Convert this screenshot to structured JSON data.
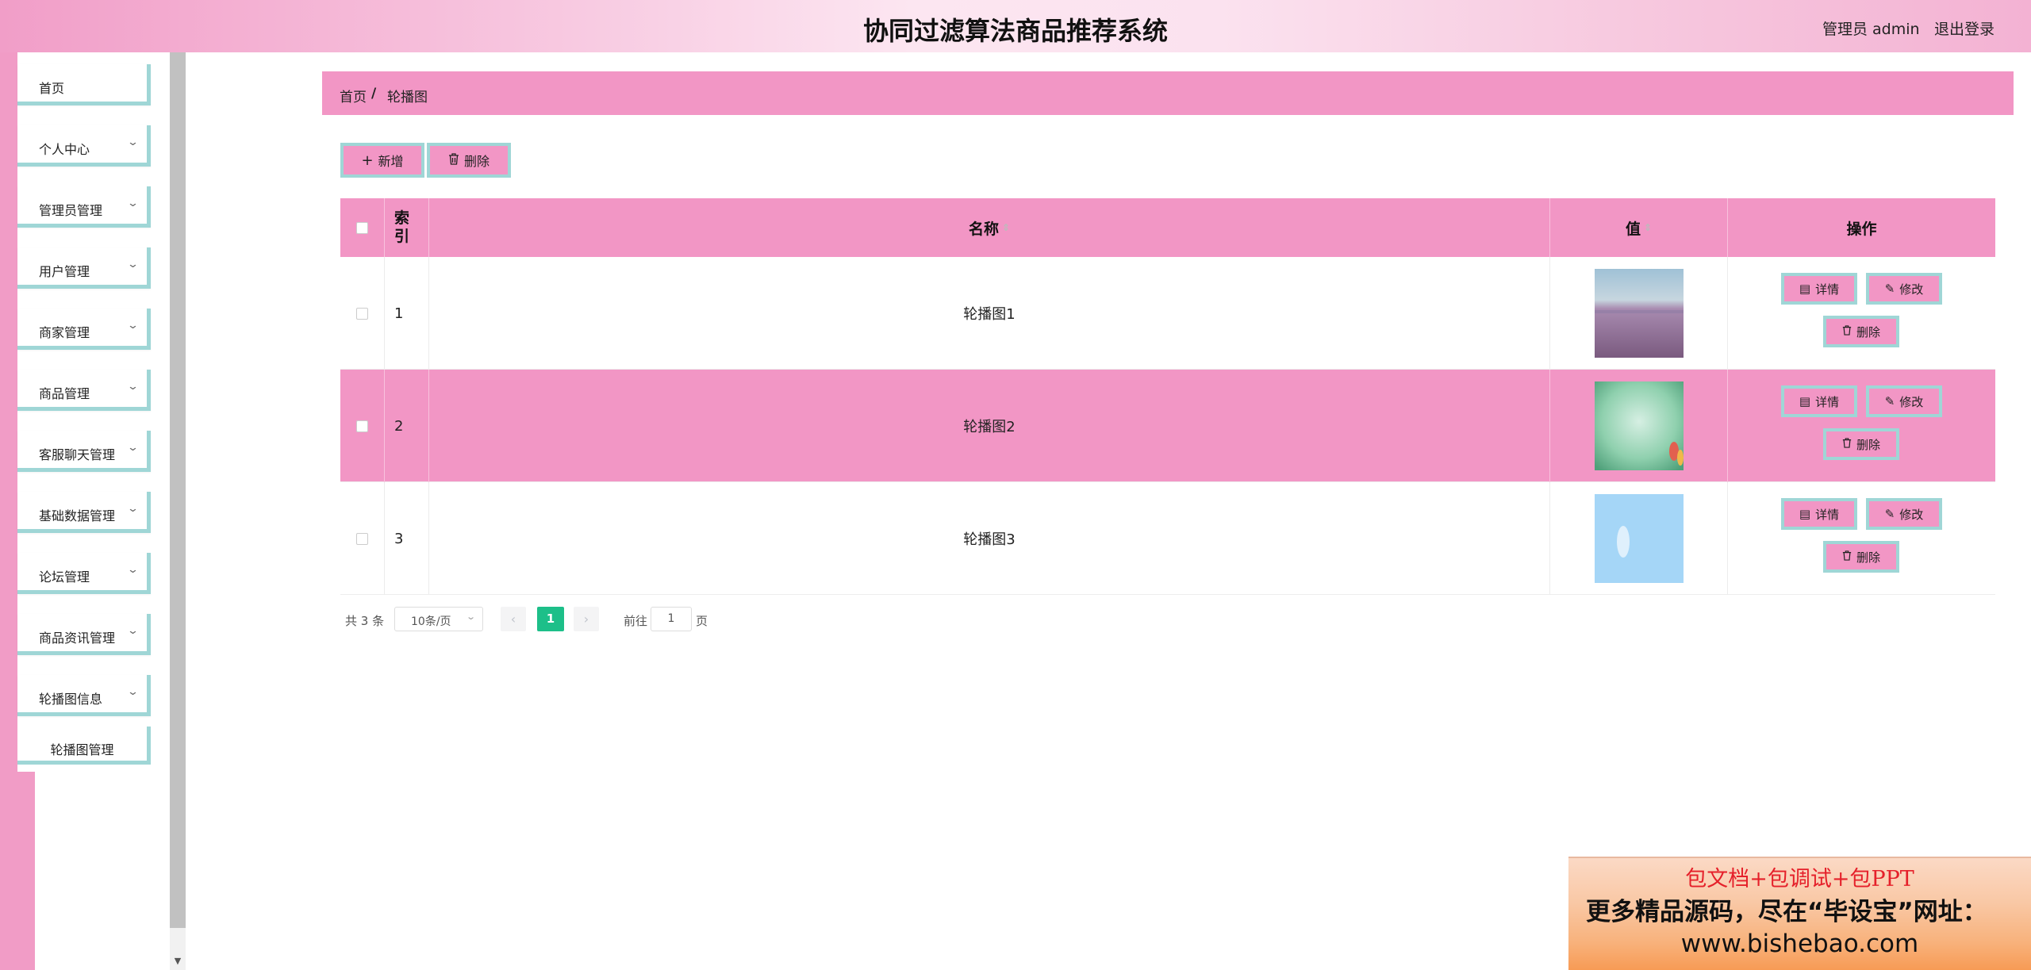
{
  "header": {
    "title": "协同过滤算法商品推荐系统",
    "user": "管理员 admin",
    "logout": "退出登录"
  },
  "sidebar": {
    "items": [
      {
        "label": "首页",
        "has_children": false
      },
      {
        "label": "个人中心",
        "has_children": true
      },
      {
        "label": "管理员管理",
        "has_children": true
      },
      {
        "label": "用户管理",
        "has_children": true
      },
      {
        "label": "商家管理",
        "has_children": true
      },
      {
        "label": "商品管理",
        "has_children": true
      },
      {
        "label": "客服聊天管理",
        "has_children": true
      },
      {
        "label": "基础数据管理",
        "has_children": true
      },
      {
        "label": "论坛管理",
        "has_children": true
      },
      {
        "label": "商品资讯管理",
        "has_children": true
      },
      {
        "label": "轮播图信息",
        "has_children": true
      }
    ],
    "sub_item": "轮播图管理"
  },
  "breadcrumb": {
    "home": "首页",
    "separator": "/",
    "current": "轮播图"
  },
  "toolbar": {
    "add_label": "新增",
    "delete_label": "删除"
  },
  "table": {
    "columns": [
      "索引",
      "名称",
      "值",
      "操作"
    ],
    "rows": [
      {
        "index": "1",
        "name": "轮播图1",
        "image": "lavender-field"
      },
      {
        "index": "2",
        "name": "轮播图2",
        "image": "green-blur-tulips"
      },
      {
        "index": "3",
        "name": "轮播图3",
        "image": "blue-sky"
      }
    ],
    "actions": {
      "detail": "详情",
      "edit": "修改",
      "delete": "删除"
    }
  },
  "pagination": {
    "total": "共 3 条",
    "page_size": "10条/页",
    "current_page": "1",
    "goto_prefix": "前往",
    "goto_value": "1",
    "goto_suffix": "页"
  },
  "ad": {
    "line1": "包文档+包调试+包PPT",
    "line2": "更多精品源码，尽在“毕设宝”网址：",
    "line3": "www.bishebao.com"
  },
  "colors": {
    "accent_pink": "#f296c5",
    "border_teal": "#9fd6d6",
    "pager_active": "#1dbf89"
  }
}
